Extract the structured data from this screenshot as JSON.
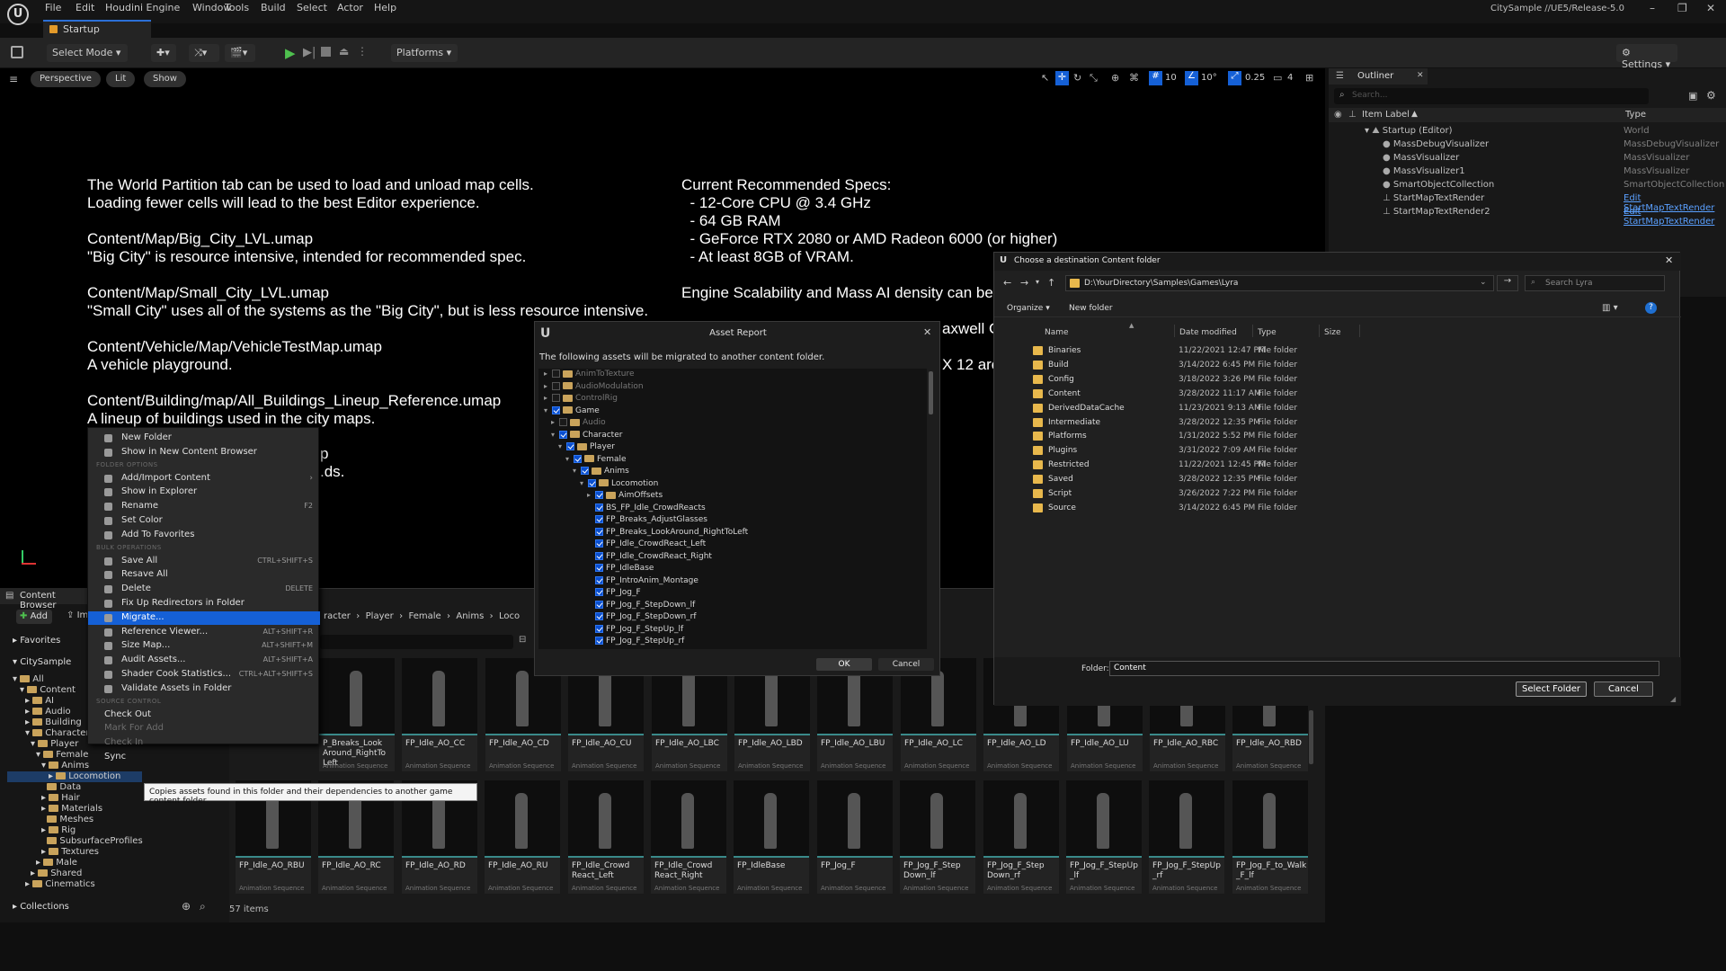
{
  "menubar": {
    "items": [
      "File",
      "Edit",
      "Houdini Engine",
      "Window",
      "Tools",
      "Build",
      "Select",
      "Actor",
      "Help"
    ],
    "project": "CitySample //UE5/Release-5.0"
  },
  "tabs": {
    "level": "Startup"
  },
  "toolbar": {
    "mode": "Select Mode",
    "platforms": "Platforms",
    "settings": "Settings"
  },
  "viewport": {
    "perspective": "Perspective",
    "lit": "Lit",
    "show": "Show",
    "snap_grid": "10",
    "snap_rot": "10°",
    "snap_scale": "0.25",
    "cam_speed": "4",
    "left_lines": [
      "The World Partition tab can be used to load and unload map cells.",
      "Loading fewer cells will lead to the best Editor experience.",
      "",
      "Content/Map/Big_City_LVL.umap",
      "\"Big City\" is resource intensive, intended for recommended spec.",
      "",
      "Content/Map/Small_City_LVL.umap",
      "\"Small City\" uses all of the systems as the \"Big City\", but is less resource intensive.",
      "",
      "Content/Vehicle/Map/VehicleTestMap.umap",
      "A vehicle playground.",
      "",
      "Content/Building/map/All_Buildings_Lineup_Reference.umap",
      "A lineup of buildings used in the city maps."
    ],
    "left_tail": [
      "p",
      ".ds."
    ],
    "right_lines": [
      "Current Recommended Specs:",
      "  - 12-Core CPU @ 3.4 GHz",
      "  - 64 GB RAM",
      "  - GeForce RTX 2080 or AMD Radeon 6000 (or higher)",
      "  - At least 8GB of VRAM.",
      "",
      "Engine Scalability and Mass AI density can be"
    ],
    "right_tail": [
      "axwell G",
      "X 12 are"
    ]
  },
  "outliner": {
    "title": "Outliner",
    "search_placeholder": "Search...",
    "col_label": "Item Label",
    "col_type": "Type",
    "rows": [
      {
        "label": "Startup (Editor)",
        "type": "World",
        "link": false
      },
      {
        "label": "MassDebugVisualizer",
        "type": "MassDebugVisualizer",
        "link": false
      },
      {
        "label": "MassVisualizer",
        "type": "MassVisualizer",
        "link": false
      },
      {
        "label": "MassVisualizer1",
        "type": "MassVisualizer",
        "link": false
      },
      {
        "label": "SmartObjectCollection",
        "type": "SmartObjectCollection",
        "link": false
      },
      {
        "label": "StartMapTextRender",
        "type": "Edit StartMapTextRender",
        "link": true
      },
      {
        "label": "StartMapTextRender2",
        "type": "Edit StartMapTextRender",
        "link": true
      }
    ]
  },
  "content_browser": {
    "title": "Content Browser",
    "add": "Add",
    "import": "Im",
    "favorites": "Favorites",
    "root": "CitySample",
    "collections": "Collections",
    "count": "57 items",
    "path": [
      "racter",
      "Player",
      "Female",
      "Anims",
      "Loco"
    ],
    "tree": [
      {
        "label": "All",
        "depth": 0
      },
      {
        "label": "Content",
        "depth": 1
      },
      {
        "label": "AI",
        "depth": 2
      },
      {
        "label": "Audio",
        "depth": 2
      },
      {
        "label": "Building",
        "depth": 2
      },
      {
        "label": "Character",
        "depth": 2
      },
      {
        "label": "Player",
        "depth": 3
      },
      {
        "label": "Female",
        "depth": 4
      },
      {
        "label": "Anims",
        "depth": 5
      },
      {
        "label": "Locomotion",
        "depth": 6
      },
      {
        "label": "Data",
        "depth": 5
      },
      {
        "label": "Hair",
        "depth": 5
      },
      {
        "label": "Materials",
        "depth": 5
      },
      {
        "label": "Meshes",
        "depth": 5
      },
      {
        "label": "Rig",
        "depth": 5
      },
      {
        "label": "SubsurfaceProfiles",
        "depth": 5
      },
      {
        "label": "Textures",
        "depth": 5
      },
      {
        "label": "Male",
        "depth": 4
      },
      {
        "label": "Shared",
        "depth": 3
      },
      {
        "label": "Cinematics",
        "depth": 2
      }
    ],
    "asset_type": "Animation Sequence",
    "row1": [
      "P_Breaks_Look Around_RightTo Left",
      "FP_Idle_AO_CC",
      "FP_Idle_AO_CD",
      "FP_Idle_AO_CU",
      "FP_Idle_AO_LBC",
      "FP_Idle_AO_LBD",
      "FP_Idle_AO_LBU",
      "FP_Idle_AO_LC",
      "FP_Idle_AO_LD",
      "FP_Idle_AO_LU",
      "FP_Idle_AO_RBC",
      "FP_Idle_AO_RBD"
    ],
    "row2": [
      "FP_Idle_AO_RBU",
      "FP_Idle_AO_RC",
      "FP_Idle_AO_RD",
      "FP_Idle_AO_RU",
      "FP_Idle_Crowd React_Left",
      "FP_Idle_Crowd React_Right",
      "FP_IdleBase",
      "FP_Jog_F",
      "FP_Jog_F_Step Down_lf",
      "FP_Jog_F_Step Down_rf",
      "FP_Jog_F_StepUp _lf",
      "FP_Jog_F_StepUp _rf",
      "FP_Jog_F_to_Walk _F_lf"
    ]
  },
  "context_menu": {
    "items": [
      {
        "label": "New Folder",
        "shortcut": "",
        "kind": "item"
      },
      {
        "label": "Show in New Content Browser",
        "shortcut": "",
        "kind": "item"
      },
      {
        "label": "FOLDER OPTIONS",
        "shortcut": "",
        "kind": "section"
      },
      {
        "label": "Add/Import Content",
        "shortcut": "",
        "kind": "item"
      },
      {
        "label": "Show in Explorer",
        "shortcut": "",
        "kind": "item"
      },
      {
        "label": "Rename",
        "shortcut": "F2",
        "kind": "item"
      },
      {
        "label": "Set Color",
        "shortcut": "",
        "kind": "item"
      },
      {
        "label": "Add To Favorites",
        "shortcut": "",
        "kind": "item"
      },
      {
        "label": "BULK OPERATIONS",
        "shortcut": "",
        "kind": "section"
      },
      {
        "label": "Save All",
        "shortcut": "CTRL+SHIFT+S",
        "kind": "item"
      },
      {
        "label": "Resave All",
        "shortcut": "",
        "kind": "item"
      },
      {
        "label": "Delete",
        "shortcut": "DELETE",
        "kind": "item"
      },
      {
        "label": "Fix Up Redirectors in Folder",
        "shortcut": "",
        "kind": "item"
      },
      {
        "label": "Migrate...",
        "shortcut": "",
        "kind": "highlight"
      },
      {
        "label": "Reference Viewer...",
        "shortcut": "ALT+SHIFT+R",
        "kind": "item"
      },
      {
        "label": "Size Map...",
        "shortcut": "ALT+SHIFT+M",
        "kind": "item"
      },
      {
        "label": "Audit Assets...",
        "shortcut": "ALT+SHIFT+A",
        "kind": "item"
      },
      {
        "label": "Shader Cook Statistics...",
        "shortcut": "CTRL+ALT+SHIFT+S",
        "kind": "item"
      },
      {
        "label": "Validate Assets in Folder",
        "shortcut": "",
        "kind": "item"
      },
      {
        "label": "SOURCE CONTROL",
        "shortcut": "",
        "kind": "section"
      },
      {
        "label": "Check Out",
        "shortcut": "",
        "kind": "plain"
      },
      {
        "label": "Mark For Add",
        "shortcut": "",
        "kind": "dim"
      },
      {
        "label": "Check In",
        "shortcut": "",
        "kind": "dim"
      },
      {
        "label": "Sync",
        "shortcut": "",
        "kind": "plain"
      }
    ],
    "tooltip": "Copies assets found in this folder and their dependencies to another game content folder."
  },
  "asset_report": {
    "title": "Asset Report",
    "message": "The following assets will be migrated to another content folder.",
    "ok": "OK",
    "cancel": "Cancel",
    "rows": [
      {
        "label": "AnimToTexture",
        "depth": 0,
        "check": false,
        "folder": true
      },
      {
        "label": "AudioModulation",
        "depth": 0,
        "check": false,
        "folder": true
      },
      {
        "label": "ControlRig",
        "depth": 0,
        "check": false,
        "folder": true
      },
      {
        "label": "Game",
        "depth": 0,
        "check": true,
        "folder": true
      },
      {
        "label": "Audio",
        "depth": 1,
        "check": false,
        "folder": true
      },
      {
        "label": "Character",
        "depth": 1,
        "check": true,
        "folder": true
      },
      {
        "label": "Player",
        "depth": 2,
        "check": true,
        "folder": true
      },
      {
        "label": "Female",
        "depth": 3,
        "check": true,
        "folder": true
      },
      {
        "label": "Anims",
        "depth": 4,
        "check": true,
        "folder": true
      },
      {
        "label": "Locomotion",
        "depth": 5,
        "check": true,
        "folder": true
      },
      {
        "label": "AimOffsets",
        "depth": 6,
        "check": true,
        "folder": true
      },
      {
        "label": "BS_FP_Idle_CrowdReacts",
        "depth": 6,
        "check": true,
        "folder": false
      },
      {
        "label": "FP_Breaks_AdjustGlasses",
        "depth": 6,
        "check": true,
        "folder": false
      },
      {
        "label": "FP_Breaks_LookAround_RightToLeft",
        "depth": 6,
        "check": true,
        "folder": false
      },
      {
        "label": "FP_Idle_CrowdReact_Left",
        "depth": 6,
        "check": true,
        "folder": false
      },
      {
        "label": "FP_Idle_CrowdReact_Right",
        "depth": 6,
        "check": true,
        "folder": false
      },
      {
        "label": "FP_IdleBase",
        "depth": 6,
        "check": true,
        "folder": false
      },
      {
        "label": "FP_IntroAnim_Montage",
        "depth": 6,
        "check": true,
        "folder": false
      },
      {
        "label": "FP_Jog_F",
        "depth": 6,
        "check": true,
        "folder": false
      },
      {
        "label": "FP_Jog_F_StepDown_lf",
        "depth": 6,
        "check": true,
        "folder": false
      },
      {
        "label": "FP_Jog_F_StepDown_rf",
        "depth": 6,
        "check": true,
        "folder": false
      },
      {
        "label": "FP_Jog_F_StepUp_lf",
        "depth": 6,
        "check": true,
        "folder": false
      },
      {
        "label": "FP_Jog_F_StepUp_rf",
        "depth": 6,
        "check": true,
        "folder": false
      }
    ]
  },
  "folder_dialog": {
    "title": "Choose a destination Content folder",
    "address": "D:\\YourDirectory\\Samples\\Games\\Lyra",
    "search_placeholder": "Search Lyra",
    "organize": "Organize",
    "new_folder": "New folder",
    "cols": {
      "name": "Name",
      "date": "Date modified",
      "type": "Type",
      "size": "Size"
    },
    "files": [
      {
        "name": "Binaries",
        "date": "11/22/2021 12:47 PM",
        "type": "File folder"
      },
      {
        "name": "Build",
        "date": "3/14/2022 6:45 PM",
        "type": "File folder"
      },
      {
        "name": "Config",
        "date": "3/18/2022 3:26 PM",
        "type": "File folder"
      },
      {
        "name": "Content",
        "date": "3/28/2022 11:17 AM",
        "type": "File folder"
      },
      {
        "name": "DerivedDataCache",
        "date": "11/23/2021 9:13 AM",
        "type": "File folder"
      },
      {
        "name": "Intermediate",
        "date": "3/28/2022 12:35 PM",
        "type": "File folder"
      },
      {
        "name": "Platforms",
        "date": "1/31/2022 5:52 PM",
        "type": "File folder"
      },
      {
        "name": "Plugins",
        "date": "3/31/2022 7:09 AM",
        "type": "File folder"
      },
      {
        "name": "Restricted",
        "date": "11/22/2021 12:45 PM",
        "type": "File folder"
      },
      {
        "name": "Saved",
        "date": "3/28/2022 12:35 PM",
        "type": "File folder"
      },
      {
        "name": "Script",
        "date": "3/26/2022 7:22 PM",
        "type": "File folder"
      },
      {
        "name": "Source",
        "date": "3/14/2022 6:45 PM",
        "type": "File folder"
      }
    ],
    "folder_label": "Folder:",
    "folder_value": "Content",
    "select": "Select Folder",
    "cancel": "Cancel"
  },
  "colors": {
    "accent": "#1560d6",
    "folder": "#c9a35b",
    "win_folder": "#e8b84c",
    "link": "#5aa0ff"
  }
}
